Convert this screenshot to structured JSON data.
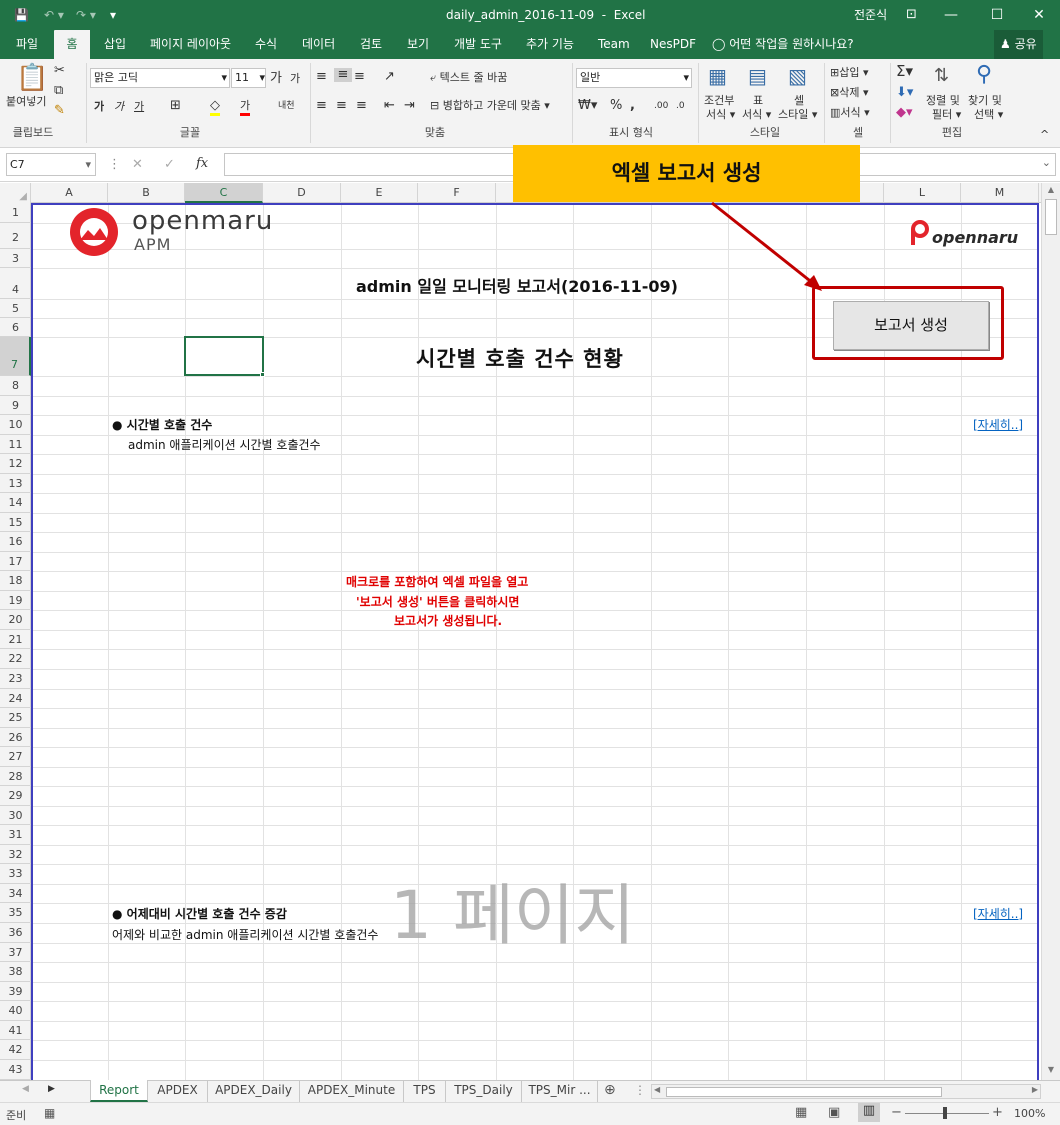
{
  "titlebar": {
    "document": "daily_admin_2016-11-09",
    "separator": "-",
    "app": "Excel",
    "user": "전준식"
  },
  "menu": [
    "파일",
    "홈",
    "삽입",
    "페이지 레이아웃",
    "수식",
    "데이터",
    "검토",
    "보기",
    "개발 도구",
    "추가 기능",
    "Team",
    "NesPDF"
  ],
  "menu_active": "홈",
  "tell_me": "어떤 작업을 원하시나요?",
  "share": "공유",
  "ribbon": {
    "paste": "붙여넣기",
    "clipboard": "클립보드",
    "font_name": "맑은 고딕",
    "font_size": "11",
    "font_group": "글꼴",
    "wrap_text": "텍스트 줄 바꿈",
    "merge_center": "병합하고 가운데 맞춤",
    "align_group": "맞춤",
    "number_format": "일반",
    "number_group": "표시 형식",
    "cond_format_1": "조건부",
    "cond_format_2": "서식",
    "table_format_1": "표",
    "table_format_2": "서식",
    "cell_style_1": "셀",
    "cell_style_2": "스타일",
    "style_group": "스타일",
    "insert": "삽입",
    "delete": "삭제",
    "format": "서식",
    "cells_group": "셀",
    "sort_1": "정렬 및",
    "sort_2": "필터",
    "find_1": "찾기 및",
    "find_2": "선택",
    "edit_group": "편집"
  },
  "namebox": "C7",
  "fx": "fx",
  "columns": [
    "A",
    "B",
    "C",
    "D",
    "E",
    "F",
    "G",
    "H",
    "I",
    "J",
    "K",
    "L",
    "M"
  ],
  "selected_column": "C",
  "rows": [
    "1",
    "2",
    "3",
    "4",
    "5",
    "6",
    "7",
    "8",
    "9",
    "10",
    "11",
    "12",
    "13",
    "14",
    "15",
    "16",
    "17",
    "18",
    "19",
    "20",
    "21",
    "22",
    "23",
    "24",
    "25",
    "26",
    "27",
    "28",
    "29",
    "30",
    "31",
    "32",
    "33",
    "34",
    "35",
    "36",
    "37",
    "38",
    "39",
    "40",
    "41",
    "42",
    "43"
  ],
  "selected_row": "7",
  "sheet": {
    "logo_left_1": "openmaru",
    "logo_left_2": "APM",
    "logo_right": "opennaru",
    "report_title": "admin 일일 모니터링 보고서(2016-11-09)",
    "section_title": "시간별 호출 건수 현황",
    "s1_heading": "● 시간별 호출 건수",
    "s1_desc": "admin 애플리케이션 시간별 호출건수",
    "s1_link": "[자세히..]",
    "notice_1": "매크로를 포함하여 엑셀 파일을 열고",
    "notice_2": "'보고서 생성' 버튼을 클릭하시면",
    "notice_3": "보고서가 생성됩니다.",
    "page_watermark": "1 페이지",
    "s2_heading": "● 어제대비 시간별 호출 건수 증감",
    "s2_desc": "어제와 비교한 admin 애플리케이션 시간별 호출건수",
    "s2_link": "[자세히..]",
    "report_button": "보고서 생성"
  },
  "callout": "엑셀 보고서 생성",
  "sheet_tabs": [
    "Report",
    "APDEX",
    "APDEX_Daily",
    "APDEX_Minute",
    "TPS",
    "TPS_Daily",
    "TPS_Mir ..."
  ],
  "active_tab": "Report",
  "status": {
    "ready": "준비",
    "zoom": "100%"
  },
  "colors": {
    "excel_green": "#217346",
    "callout_bg": "#ffc000",
    "highlight_red": "#c00000",
    "notice_red": "#e00000",
    "link_blue": "#0563c1",
    "page_border": "#3f3fbf"
  }
}
